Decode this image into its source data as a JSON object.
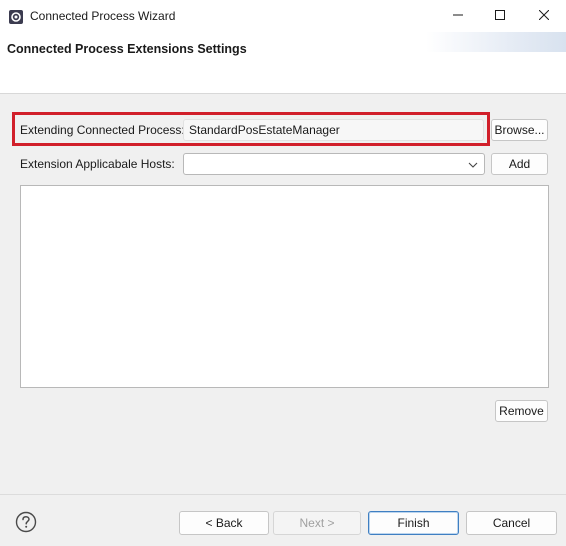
{
  "window": {
    "title": "Connected Process Wizard",
    "controls": {
      "minimize": "minimize-icon",
      "maximize": "maximize-icon",
      "close": "close-icon"
    }
  },
  "header": {
    "title": "Connected Process Extensions Settings"
  },
  "form": {
    "extending_process": {
      "label": "Extending Connected Process:",
      "value": "StandardPosEstateManager",
      "browse_label": "Browse...",
      "highlight_color": "#d11f2a"
    },
    "hosts": {
      "label": "Extension Applicabale Hosts:",
      "selected": "",
      "add_label": "Add"
    },
    "hosts_list": {
      "items": []
    },
    "remove_label": "Remove"
  },
  "footer": {
    "help_icon": "help-icon",
    "back_label": "< Back",
    "next_label": "Next >",
    "finish_label": "Finish",
    "cancel_label": "Cancel"
  }
}
